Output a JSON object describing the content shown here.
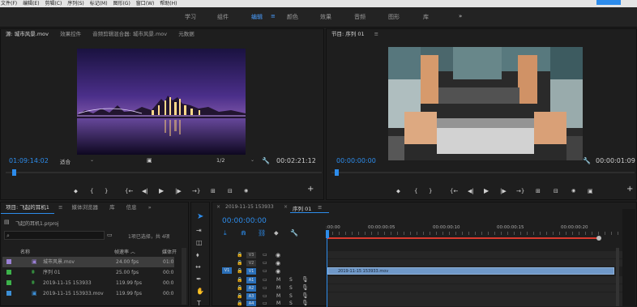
{
  "menu": [
    "文件(F)",
    "编辑(E)",
    "剪辑(C)",
    "序列(S)",
    "标记(M)",
    "图形(G)",
    "窗口(W)",
    "帮助(H)"
  ],
  "workspaces": {
    "items": [
      "学习",
      "组件",
      "编辑",
      "颜色",
      "效果",
      "音频",
      "图形",
      "库"
    ],
    "active": "编辑",
    "more": "»"
  },
  "source": {
    "tabs": [
      "源: 城市风景.mov",
      "效果控件",
      "音频剪辑混合器: 城市风景.mov",
      "元数据"
    ],
    "timecode": "01:09:14:02",
    "fit": "适合",
    "resolution": "1/2",
    "duration": "00:02:21:12"
  },
  "program": {
    "tab": "节目: 序列 01",
    "timecode": "00:00:00:00",
    "duration": "00:00:01:09"
  },
  "transport": {
    "marker": "⬥",
    "in": "{",
    "out": "}",
    "goto_in": "{←",
    "step_back": "◀|",
    "play": "▶",
    "step_fwd": "|▶",
    "goto_out": "→}",
    "insert": "⊞",
    "overwrite": "⊟",
    "export": "📷",
    "add": "+"
  },
  "project": {
    "tabs": [
      "项目: 飞起的耳机1",
      "媒体浏览器",
      "库",
      "信息"
    ],
    "more": "»",
    "file": "飞起的耳机1.prproj",
    "selection": "1项已选择，共 4项",
    "columns": {
      "name": "名称",
      "fps": "帧速率 ︿",
      "start": "媒体开"
    },
    "items": [
      {
        "name": "城市风景.mov",
        "fps": "24.00 fps",
        "start": "01:0",
        "color": "#9b80d6",
        "icon": "clip-icon",
        "selected": true
      },
      {
        "name": "序列 01",
        "fps": "25.00 fps",
        "start": "00:0",
        "color": "#3cb24a",
        "icon": "sequence-icon",
        "selected": false
      },
      {
        "name": "2019-11-15 153933",
        "fps": "119.99 fps",
        "start": "00:0",
        "color": "#3cb24a",
        "icon": "sequence-icon",
        "selected": false
      },
      {
        "name": "2019-11-15 153933.mov",
        "fps": "119.99 fps",
        "start": "00:0",
        "color": "#3c8fd6",
        "icon": "clip-icon",
        "selected": false
      }
    ]
  },
  "timeline": {
    "tabs": [
      "2019-11-15 153933",
      "序列 01"
    ],
    "timecode": "00:00:00:00",
    "ruler": [
      ":00:00",
      "00:00:00:05",
      "00:00:00:10",
      "00:00:00:15",
      "00:00:00:20"
    ],
    "video_tracks": [
      "V3",
      "V2",
      "V1"
    ],
    "audio_tracks": [
      "A1",
      "A2",
      "A3",
      "A4"
    ],
    "source_patch": "V1",
    "mute": "M",
    "solo": "S",
    "clip": "2019-11-15 153933.mov"
  }
}
